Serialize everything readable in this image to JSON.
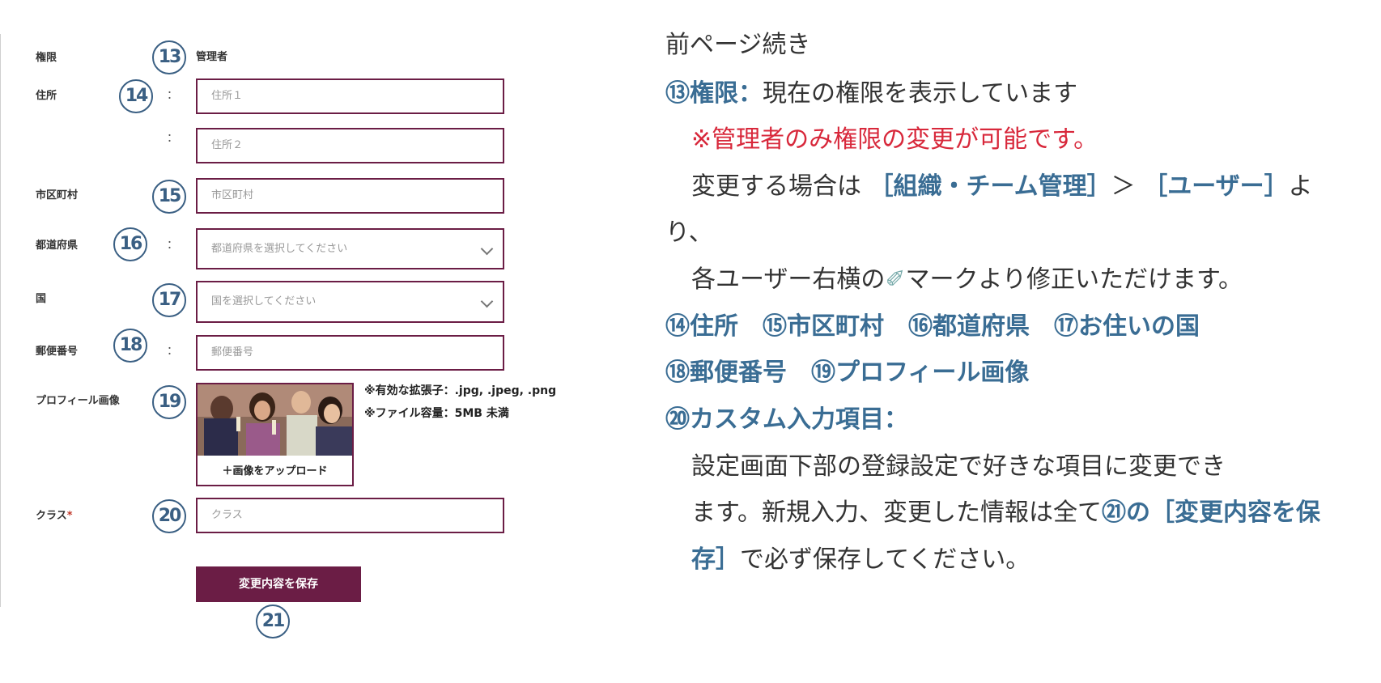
{
  "form": {
    "labels": {
      "authority": "権限",
      "address": "住所",
      "city": "市区町村",
      "prefecture": "都道府県",
      "country": "国",
      "postal": "郵便番号",
      "profile_image": "プロフィール画像",
      "class": "クラス",
      "required_mark": "*"
    },
    "colon": "：",
    "authority_value": "管理者",
    "placeholders": {
      "address1": "住所１",
      "address2": "住所２",
      "city": "市区町村",
      "prefecture": "都道府県を選択してください",
      "country": "国を選択してください",
      "postal": "郵便番号",
      "class": "クラス"
    },
    "upload_label": "＋画像をアップロード",
    "notes": [
      "※有効な拡張子：.jpg, .jpeg, .png",
      "※ファイル容量：5MB 未満"
    ],
    "save_button": "変更内容を保存"
  },
  "numbers": {
    "n13": "13",
    "n14": "14",
    "n15": "15",
    "n16": "16",
    "n17": "17",
    "n18": "18",
    "n19": "19",
    "n20": "20",
    "n21": "21"
  },
  "description": {
    "cont": "前ページ続き",
    "l1_num": "⑬",
    "l1_head": "権限：",
    "l1_text": "現在の権限を表示しています",
    "l2": "※管理者のみ権限の変更が可能です。",
    "l3_a": "変更する場合は",
    "l3_b": "［組織・チーム管理］",
    "l3_c": "＞",
    "l3_d": "［ユーザー］",
    "l3_e": "よ",
    "l4": "り、",
    "l5_a": "各ユーザー右横の",
    "l5_icon": "✐",
    "l5_b": "マークより修正いただけます。",
    "l6": "⑭住所　⑮市区町村　⑯都道府県　⑰お住いの国",
    "l7": "⑱郵便番号　⑲プロフィール画像",
    "l8": "⑳カスタム入力項目：",
    "l9": "設定画面下部の登録設定で好きな項目に変更でき",
    "l10_a": "ます。新規入力、変更した情報は全て",
    "l10_b": "㉑の［変更内容を保",
    "l11_a": "存］",
    "l11_b": "で必ず保存してください。"
  },
  "colors": {
    "accent": "#6b1d45",
    "number_blue": "#3a5f83",
    "highlight_blue": "#3a6d94",
    "warning_red": "#d8283b"
  }
}
